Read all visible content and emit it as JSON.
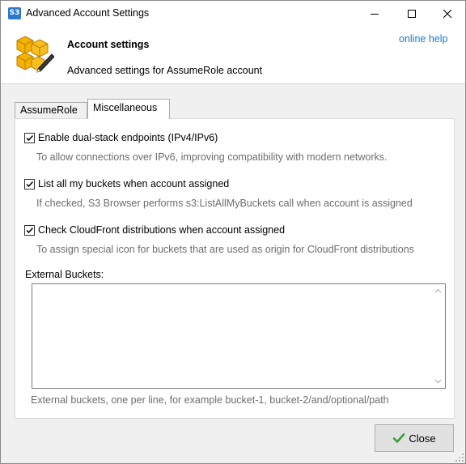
{
  "window": {
    "title": "Advanced Account Settings",
    "app_icon_text": "S3"
  },
  "header": {
    "title": "Account settings",
    "subtitle": "Advanced settings for AssumeRole account",
    "help_link": "online help"
  },
  "tabs": [
    {
      "label": "AssumeRole",
      "active": false
    },
    {
      "label": "Miscellaneous",
      "active": true
    }
  ],
  "options": [
    {
      "label": "Enable dual-stack endpoints (IPv4/IPv6)",
      "checked": true,
      "description": "To allow connections over IPv6, improving compatibility with modern networks."
    },
    {
      "label": "List all my buckets when account assigned",
      "checked": true,
      "description": "If checked, S3 Browser performs s3:ListAllMyBuckets call when account is assigned"
    },
    {
      "label": "Check CloudFront distributions when account assigned",
      "checked": true,
      "description": "To assign special icon for buckets that are used as origin for CloudFront distributions"
    }
  ],
  "external_buckets": {
    "label": "External Buckets:",
    "value": "",
    "hint": "External buckets, one per line, for example bucket-1, bucket-2/and/optional/path"
  },
  "buttons": {
    "close_label": "Close"
  },
  "colors": {
    "link": "#1f78c8",
    "accent_icon": "#f5b301",
    "check_green": "#3aa03a"
  }
}
